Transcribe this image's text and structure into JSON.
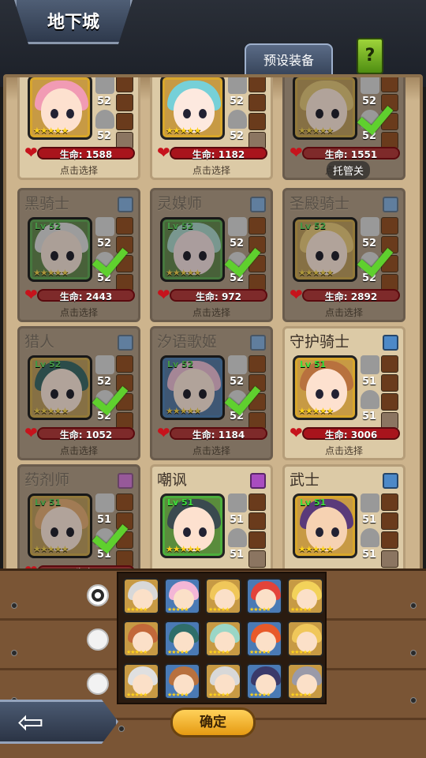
{
  "header": {
    "title": "地下城",
    "preset_tab": "预设装备",
    "help": "?"
  },
  "auto_label": "托管关",
  "heroes": [
    {
      "name": "",
      "hp_label": "生命:",
      "hp": "1588",
      "select": "点击选择",
      "level": "",
      "equip_a": "52",
      "equip_b": "52",
      "selected": false,
      "active": true,
      "rarity": "legend",
      "hair": "#f19bb4",
      "face": "#fde1cf",
      "row": 0,
      "col": 0
    },
    {
      "name": "",
      "hp_label": "生命:",
      "hp": "1182",
      "select": "点击选择",
      "level": "",
      "equip_a": "52",
      "equip_b": "52",
      "selected": false,
      "active": true,
      "rarity": "legend",
      "hair": "#76d0d8",
      "face": "#fde9df",
      "row": 0,
      "col": 1
    },
    {
      "name": "",
      "hp_label": "生命:",
      "hp": "1551",
      "select": "点击选择",
      "level": "",
      "equip_a": "52",
      "equip_b": "52",
      "selected": true,
      "active": false,
      "rarity": "legend",
      "hair": "#e9c35a",
      "face": "#fde1cf",
      "row": 0,
      "col": 2
    },
    {
      "name": "黑骑士",
      "hp_label": "生命:",
      "hp": "2443",
      "select": "点击选择",
      "level": "Lv 52",
      "equip_a": "52",
      "equip_b": "52",
      "selected": true,
      "active": false,
      "rarity": "rare",
      "hair": "#d8d8d8",
      "face": "#f4dccb",
      "row": 1,
      "col": 0
    },
    {
      "name": "灵媒师",
      "hp_label": "生命:",
      "hp": "972",
      "select": "点击选择",
      "level": "Lv 52",
      "equip_a": "52",
      "equip_b": "52",
      "selected": true,
      "active": false,
      "rarity": "rare",
      "hair": "#9ad6c6",
      "face": "#f2d8d8",
      "row": 1,
      "col": 1
    },
    {
      "name": "圣殿骑士",
      "hp_label": "生命:",
      "hp": "2892",
      "select": "点击选择",
      "level": "Lv 52",
      "equip_a": "52",
      "equip_b": "52",
      "selected": true,
      "active": false,
      "rarity": "legend",
      "hair": "#f0c75a",
      "face": "#fde1cf",
      "row": 1,
      "col": 2
    },
    {
      "name": "猎人",
      "hp_label": "生命:",
      "hp": "1052",
      "select": "点击选择",
      "level": "Lv 52",
      "equip_a": "52",
      "equip_b": "52",
      "selected": true,
      "active": false,
      "rarity": "legend",
      "hair": "#2f6e6a",
      "face": "#fde1cf",
      "row": 2,
      "col": 0
    },
    {
      "name": "汐语歌姬",
      "hp_label": "生命:",
      "hp": "1184",
      "select": "点击选择",
      "level": "Lv 52",
      "equip_a": "52",
      "equip_b": "52",
      "selected": true,
      "active": false,
      "rarity": "epic",
      "hair": "#f3b6d6",
      "face": "#fde1cf",
      "row": 2,
      "col": 1
    },
    {
      "name": "守护骑士",
      "hp_label": "生命:",
      "hp": "3006",
      "select": "点击选择",
      "level": "Lv 51",
      "equip_a": "51",
      "equip_b": "51",
      "selected": false,
      "active": true,
      "rarity": "legend",
      "hair": "#b8713e",
      "face": "#fde1cf",
      "row": 2,
      "col": 2
    },
    {
      "name": "药剂师",
      "hp_label": "生命:",
      "hp": "",
      "select": "",
      "level": "Lv 51",
      "equip_a": "51",
      "equip_b": "51",
      "selected": true,
      "active": false,
      "rarity": "legend",
      "hair": "#f3a85a",
      "face": "#fde1cf",
      "row": 3,
      "col": 0
    },
    {
      "name": "嘲讽",
      "hp_label": "",
      "hp": "",
      "select": "",
      "level": "Lv 51",
      "equip_a": "51",
      "equip_b": "51",
      "selected": false,
      "active": true,
      "rarity": "rare",
      "hair": "#3a4a4f",
      "face": "#fde1cf",
      "row": 3,
      "col": 1
    },
    {
      "name": "武士",
      "hp_label": "",
      "hp": "",
      "select": "",
      "level": "Lv 51",
      "equip_a": "51",
      "equip_b": "51",
      "selected": false,
      "active": true,
      "rarity": "legend",
      "hair": "#5a3a7a",
      "face": "#f6d2b2",
      "row": 3,
      "col": 2
    }
  ],
  "teams": [
    {
      "selected": true,
      "members": [
        "#d8d8d8",
        "#f3b6d6",
        "#f0c75a",
        "#e3433a",
        "#f3d25a"
      ]
    },
    {
      "selected": false,
      "members": [
        "#c2683a",
        "#2f6e6a",
        "#9ad6c6",
        "#e85a2a",
        "#f0c75a"
      ]
    },
    {
      "selected": false,
      "members": [
        "#e0e0e0",
        "#b8713e",
        "#d8d8d8",
        "#3a3a6a",
        "#9a9aa8"
      ]
    }
  ],
  "footer": {
    "back": "⇦",
    "confirm": "确定"
  },
  "stars": "★★★★★"
}
